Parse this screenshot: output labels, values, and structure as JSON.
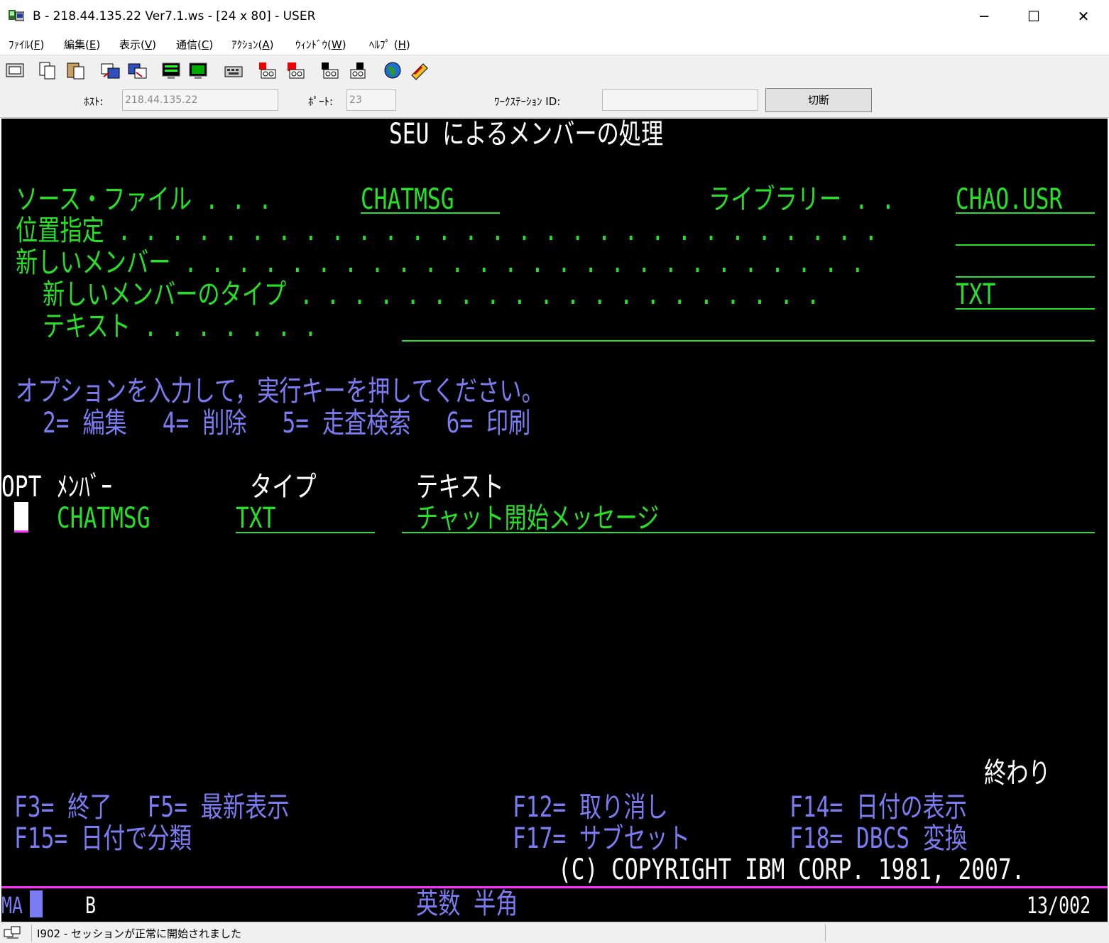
{
  "window": {
    "title": "B - 218.44.135.22 Ver7.1.ws - [24 x 80] - USER",
    "minimize": "─",
    "maximize": "☐",
    "close": "✕"
  },
  "menu": [
    {
      "label": "ﾌｧｲﾙ(",
      "key": "F",
      "end": ")"
    },
    {
      "label": "編集(",
      "key": "E",
      "end": ")"
    },
    {
      "label": "表示(",
      "key": "V",
      "end": ")"
    },
    {
      "label": "通信(",
      "key": "C",
      "end": ")"
    },
    {
      "label": "ｱｸｼｮﾝ(",
      "key": "A",
      "end": ")"
    },
    {
      "label": "ｳｨﾝﾄﾞｳ(",
      "key": "W",
      "end": ")"
    },
    {
      "label": "ﾍﾙﾌﾟ (",
      "key": "H",
      "end": ")"
    }
  ],
  "toolbar_icons": [
    "print-screen-icon",
    "copy-icon",
    "paste-icon",
    "send-file-icon",
    "receive-file-icon",
    "display-setup-icon",
    "color-setup-icon",
    "keyboard-map-icon",
    "macro-record-icon",
    "macro-stop-icon",
    "macro-play-icon",
    "macro-edit-icon",
    "web-icon",
    "settings-edit-icon"
  ],
  "connection": {
    "host_label": "ﾎｽﾄ:",
    "host_value": "218.44.135.22",
    "port_label": "ﾎﾟｰﾄ:",
    "port_value": "23",
    "ws_label": "ﾜｰｸｽﾃｰｼｮﾝ ID:",
    "ws_value": "",
    "disconnect": "切断"
  },
  "screen": {
    "title": "SEU によるメンバーの処理",
    "source_file_label": "ソース・ファイル . . .",
    "source_file_value": "CHATMSG",
    "library_label": "ライブラリー . .",
    "library_value": "CHAO.USR",
    "position_label": "位置指定 . . . . . . . . . . . . . . . . . . . . . . . . . . . . .",
    "position_value": "",
    "new_member_label": "新しいメンバー . . . . . . . . . . . . . . . . . . . . . . . . . .",
    "new_member_value": "",
    "new_member_type_label": "新しいメンバーのタイプ . . . . . . . . . . . . . . . . . . . .",
    "new_member_type_value": "TXT",
    "text_label": "テキスト . . . . . . .",
    "text_value": "",
    "instructions": "オプションを入力して，実行キーを押してください。",
    "options": "2= 編集　 4= 削除　 5= 走査検索　 6= 印刷",
    "col_opt": "OPT",
    "col_member": "ﾒﾝﾊﾞｰ",
    "col_type": "タイプ",
    "col_text": "テキスト",
    "rows": [
      {
        "opt": "",
        "member": "CHATMSG",
        "type": "TXT",
        "text": "チャット開始メッセージ"
      }
    ],
    "more": "終わり",
    "fkeys_line1_left": "F3= 終了　 F5= 最新表示",
    "fkeys_line1_mid": "F12= 取り消し",
    "fkeys_line1_right": "F14= 日付の表示",
    "fkeys_line2_left": "F15= 日付で分類",
    "fkeys_line2_mid": "F17= サブセット",
    "fkeys_line2_right": "F18= DBCS 変換",
    "copyright": "(C) COPYRIGHT IBM CORP. 1981, 2007."
  },
  "oia": {
    "mode": "MA",
    "session": "B",
    "input_mode": "英数 半角",
    "cursor_pos": "13/002"
  },
  "status": {
    "message": "I902 - セッションが正常に開始されました"
  }
}
